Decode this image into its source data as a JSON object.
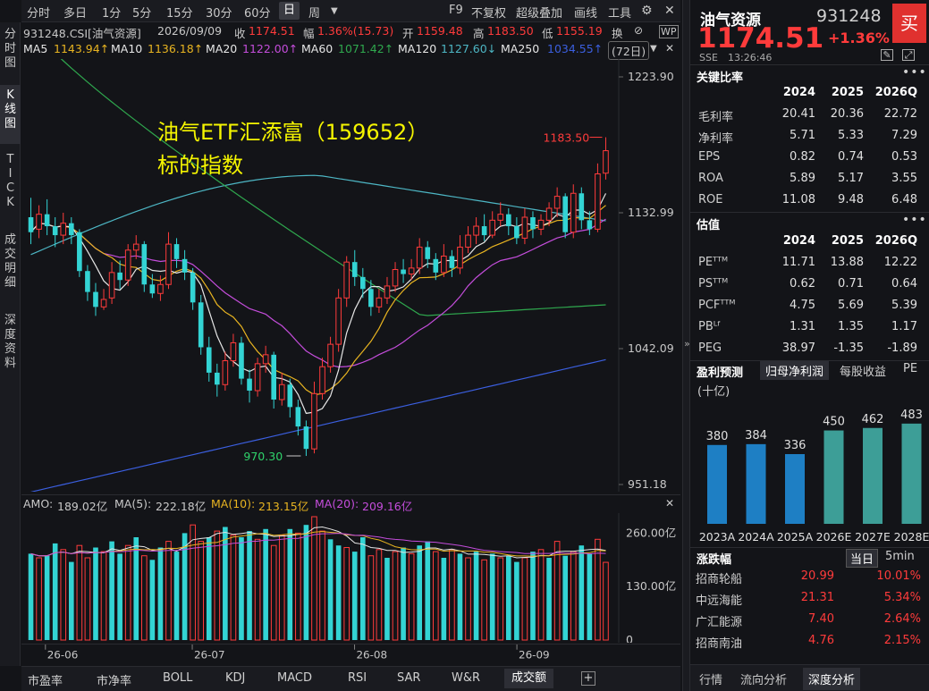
{
  "periods": [
    "分时",
    "多日",
    "1分",
    "5分",
    "15分",
    "30分",
    "60分",
    "日",
    "周"
  ],
  "active_period": "日",
  "toolbar_right": {
    "f9": "F9",
    "fuquan": "不复权",
    "overlay": "超级叠加",
    "draw": "画线",
    "tools": "工具"
  },
  "left_tabs": [
    "分\n时\n图",
    "K\n线\n图",
    "T\nI\nC\nK",
    "成\n交\n明\n细",
    "深\n度\n资\n料"
  ],
  "info": {
    "code": "931248.CSI[油气资源]",
    "date": "2026/09/09",
    "close_label": "收",
    "close": "1174.51",
    "amp_label": "幅",
    "amp": "1.36%(15.73)",
    "open_label": "开",
    "open": "1159.48",
    "high_label": "高",
    "high": "1183.50",
    "low_label": "低",
    "low": "1155.19",
    "swap": "换"
  },
  "ma": {
    "ma5_label": "MA5",
    "ma5": "1143.94↑",
    "ma10_label": "MA10",
    "ma10": "1136.18↑",
    "ma20_label": "MA20",
    "ma20": "1122.00↑",
    "ma60_label": "MA60",
    "ma60": "1071.42↑",
    "ma120_label": "MA120",
    "ma120": "1127.60↓",
    "ma250_label": "MA250",
    "ma250": "1034.55↑",
    "days": "(72日)"
  },
  "chart_data": {
    "type": "candlestick",
    "y_ticks": [
      "1223.90",
      "1132.99",
      "1042.09",
      "951.18"
    ],
    "ylim": [
      951.18,
      1223.9
    ],
    "high_marker": "1183.50",
    "low_marker": "970.30",
    "annotation_line1": "油气ETF汇添富（159652）",
    "annotation_line2": "标的指数",
    "x_labels": [
      "26-06",
      "26-07",
      "26-08",
      "26-09"
    ],
    "candles": [
      [
        1130,
        1120,
        1143,
        1112
      ],
      [
        1122,
        1132,
        1138,
        1116
      ],
      [
        1132,
        1124,
        1142,
        1118
      ],
      [
        1124,
        1118,
        1130,
        1110
      ],
      [
        1118,
        1126,
        1133,
        1112
      ],
      [
        1126,
        1118,
        1130,
        1112
      ],
      [
        1120,
        1094,
        1122,
        1090
      ],
      [
        1094,
        1080,
        1098,
        1074
      ],
      [
        1080,
        1070,
        1086,
        1064
      ],
      [
        1070,
        1075,
        1082,
        1068
      ],
      [
        1076,
        1093,
        1100,
        1072
      ],
      [
        1093,
        1088,
        1101,
        1082
      ],
      [
        1088,
        1108,
        1112,
        1084
      ],
      [
        1108,
        1112,
        1118,
        1102
      ],
      [
        1112,
        1085,
        1114,
        1080
      ],
      [
        1085,
        1079,
        1092,
        1076
      ],
      [
        1079,
        1085,
        1091,
        1074
      ],
      [
        1085,
        1112,
        1120,
        1082
      ],
      [
        1112,
        1102,
        1116,
        1096
      ],
      [
        1102,
        1093,
        1108,
        1088
      ],
      [
        1093,
        1073,
        1096,
        1068
      ],
      [
        1073,
        1043,
        1078,
        1038
      ],
      [
        1043,
        1026,
        1050,
        1020
      ],
      [
        1026,
        1018,
        1032,
        1010
      ],
      [
        1018,
        1034,
        1040,
        1014
      ],
      [
        1034,
        1046,
        1052,
        1030
      ],
      [
        1046,
        1022,
        1050,
        1018
      ],
      [
        1022,
        1014,
        1028,
        1006
      ],
      [
        1014,
        1032,
        1036,
        1010
      ],
      [
        1032,
        1038,
        1044,
        1026
      ],
      [
        1038,
        1008,
        1040,
        1002
      ],
      [
        1008,
        1018,
        1026,
        1004
      ],
      [
        1018,
        1003,
        1022,
        996
      ],
      [
        1003,
        990,
        1008,
        984
      ],
      [
        990,
        975,
        994,
        970.3
      ],
      [
        975,
        1012,
        1020,
        972
      ],
      [
        1012,
        1030,
        1036,
        1008
      ],
      [
        1030,
        1045,
        1050,
        1026
      ],
      [
        1045,
        1076,
        1082,
        1040
      ],
      [
        1076,
        1100,
        1104,
        1070
      ],
      [
        1100,
        1090,
        1108,
        1084
      ],
      [
        1090,
        1082,
        1096,
        1076
      ],
      [
        1082,
        1070,
        1088,
        1064
      ],
      [
        1070,
        1076,
        1082,
        1066
      ],
      [
        1076,
        1084,
        1090,
        1072
      ],
      [
        1084,
        1095,
        1100,
        1080
      ],
      [
        1095,
        1092,
        1102,
        1086
      ],
      [
        1092,
        1096,
        1102,
        1088
      ],
      [
        1096,
        1110,
        1116,
        1092
      ],
      [
        1110,
        1102,
        1114,
        1096
      ],
      [
        1102,
        1093,
        1106,
        1088
      ],
      [
        1093,
        1104,
        1112,
        1090
      ],
      [
        1104,
        1096,
        1108,
        1090
      ],
      [
        1096,
        1110,
        1118,
        1092
      ],
      [
        1110,
        1118,
        1124,
        1106
      ],
      [
        1118,
        1124,
        1130,
        1112
      ],
      [
        1124,
        1118,
        1132,
        1114
      ],
      [
        1118,
        1128,
        1134,
        1116
      ],
      [
        1128,
        1132,
        1140,
        1124
      ],
      [
        1132,
        1124,
        1136,
        1118
      ],
      [
        1124,
        1116,
        1130,
        1112
      ],
      [
        1116,
        1130,
        1136,
        1112
      ],
      [
        1130,
        1122,
        1134,
        1116
      ],
      [
        1122,
        1128,
        1132,
        1118
      ],
      [
        1128,
        1136,
        1140,
        1124
      ],
      [
        1136,
        1144,
        1150,
        1130
      ],
      [
        1144,
        1120,
        1146,
        1116
      ],
      [
        1120,
        1146,
        1152,
        1116
      ],
      [
        1146,
        1128,
        1150,
        1122
      ],
      [
        1128,
        1122,
        1134,
        1118
      ],
      [
        1122,
        1159,
        1166,
        1120
      ],
      [
        1159.48,
        1174.51,
        1183.5,
        1155.19
      ]
    ]
  },
  "vol": {
    "amo_label": "AMO:",
    "amo": "189.02亿",
    "ma5_label": "MA(5):",
    "ma5": "222.18亿",
    "ma10_label": "MA(10):",
    "ma10": "213.15亿",
    "ma20_label": "MA(20):",
    "ma20": "209.16亿",
    "ticks": [
      "260.00亿",
      "130.00亿",
      "0"
    ],
    "ylim": [
      0,
      300
    ],
    "values": [
      210,
      200,
      205,
      235,
      220,
      190,
      230,
      200,
      225,
      215,
      240,
      210,
      230,
      250,
      205,
      195,
      225,
      240,
      215,
      260,
      280,
      240,
      250,
      265,
      275,
      255,
      250,
      265,
      245,
      270,
      230,
      255,
      270,
      260,
      280,
      300,
      265,
      245,
      230,
      225,
      215,
      250,
      205,
      220,
      200,
      215,
      225,
      210,
      230,
      240,
      215,
      200,
      220,
      210,
      200,
      215,
      195,
      210,
      200,
      205,
      190,
      200,
      215,
      220,
      200,
      240,
      205,
      215,
      230,
      210,
      245,
      189
    ],
    "colors": [
      "c",
      "r",
      "c",
      "c",
      "r",
      "c",
      "r",
      "r",
      "c",
      "r",
      "c",
      "c",
      "r",
      "c",
      "r",
      "c",
      "c",
      "r",
      "c",
      "c",
      "r",
      "r",
      "c",
      "r",
      "c",
      "r",
      "c",
      "c",
      "r",
      "c",
      "r",
      "r",
      "c",
      "r",
      "c",
      "r",
      "r",
      "c",
      "c",
      "r",
      "c",
      "c",
      "r",
      "r",
      "c",
      "r",
      "c",
      "r",
      "c",
      "c",
      "r",
      "c",
      "r",
      "c",
      "r",
      "c",
      "r",
      "c",
      "r",
      "c",
      "c",
      "r",
      "c",
      "r",
      "c",
      "r",
      "c",
      "r",
      "c",
      "c",
      "r",
      "r"
    ]
  },
  "bottom_tabs": [
    "市盈率",
    "市净率",
    "BOLL",
    "KDJ",
    "MACD",
    "RSI",
    "SAR",
    "W&R",
    "成交额"
  ],
  "active_bottom": "成交额",
  "stock": {
    "name": "油气资源",
    "code": "931248",
    "buy": "买",
    "price": "1174.51",
    "change": "+1.36%",
    "exchange": "SSE",
    "time": "13:26:46"
  },
  "ratios": {
    "title": "关键比率",
    "years": [
      "2024",
      "2025",
      "2026Q"
    ],
    "rows": [
      {
        "name": "毛利率",
        "v": [
          "20.41",
          "20.36",
          "22.72"
        ]
      },
      {
        "name": "净利率",
        "v": [
          "5.71",
          "5.33",
          "7.29"
        ]
      },
      {
        "name": "EPS",
        "v": [
          "0.82",
          "0.74",
          "0.53"
        ]
      },
      {
        "name": "ROA",
        "v": [
          "5.89",
          "5.17",
          "3.55"
        ]
      },
      {
        "name": "ROE",
        "v": [
          "11.08",
          "9.48",
          "6.48"
        ]
      }
    ]
  },
  "valuation": {
    "title": "估值",
    "years": [
      "2024",
      "2025",
      "2026Q"
    ],
    "rows": [
      {
        "name": "PEᵀᵀᴹ",
        "v": [
          "11.71",
          "13.88",
          "12.22"
        ]
      },
      {
        "name": "PSᵀᵀᴹ",
        "v": [
          "0.62",
          "0.71",
          "0.64"
        ]
      },
      {
        "name": "PCFᵀᵀᴹ",
        "v": [
          "4.75",
          "5.69",
          "5.39"
        ]
      },
      {
        "name": "PBᴸᶠ",
        "v": [
          "1.31",
          "1.35",
          "1.17"
        ]
      },
      {
        "name": "PEG",
        "v": [
          "38.97",
          "-1.35",
          "-1.89"
        ]
      }
    ]
  },
  "forecast": {
    "title": "盈利预测",
    "tabs": [
      "归母净利润",
      "每股收益",
      "PE"
    ],
    "unit": "(十亿)",
    "years": [
      "2023A",
      "2024A",
      "2025A",
      "2026E",
      "2027E",
      "2028E"
    ],
    "values": [
      380,
      384,
      336,
      450,
      462,
      483
    ],
    "colors": [
      "#1e7fc4",
      "#1e7fc4",
      "#1e7fc4",
      "#3d9e97",
      "#3d9e97",
      "#3d9e97"
    ]
  },
  "movers": {
    "title": "涨跌幅",
    "tabs": [
      "当日",
      "5min"
    ],
    "rows": [
      {
        "name": "招商轮船",
        "price": "20.99",
        "pct": "10.01%"
      },
      {
        "name": "中远海能",
        "price": "21.31",
        "pct": "5.34%"
      },
      {
        "name": "广汇能源",
        "price": "7.40",
        "pct": "2.64%"
      },
      {
        "name": "招商南油",
        "price": "4.76",
        "pct": "2.15%"
      }
    ]
  },
  "right_bottom_tabs": [
    "行情",
    "流向分析",
    "深度分析"
  ],
  "right_bottom_active": "深度分析",
  "colors": {
    "up": "#ff3b3b",
    "down": "#33d4d4",
    "ma5": "#e6e6e6",
    "ma10": "#e8b421",
    "ma20": "#c44ddb",
    "ma60": "#2fa84e",
    "ma120": "#4db6c4",
    "ma250": "#3b5fe0",
    "annotation": "#f5f500"
  }
}
